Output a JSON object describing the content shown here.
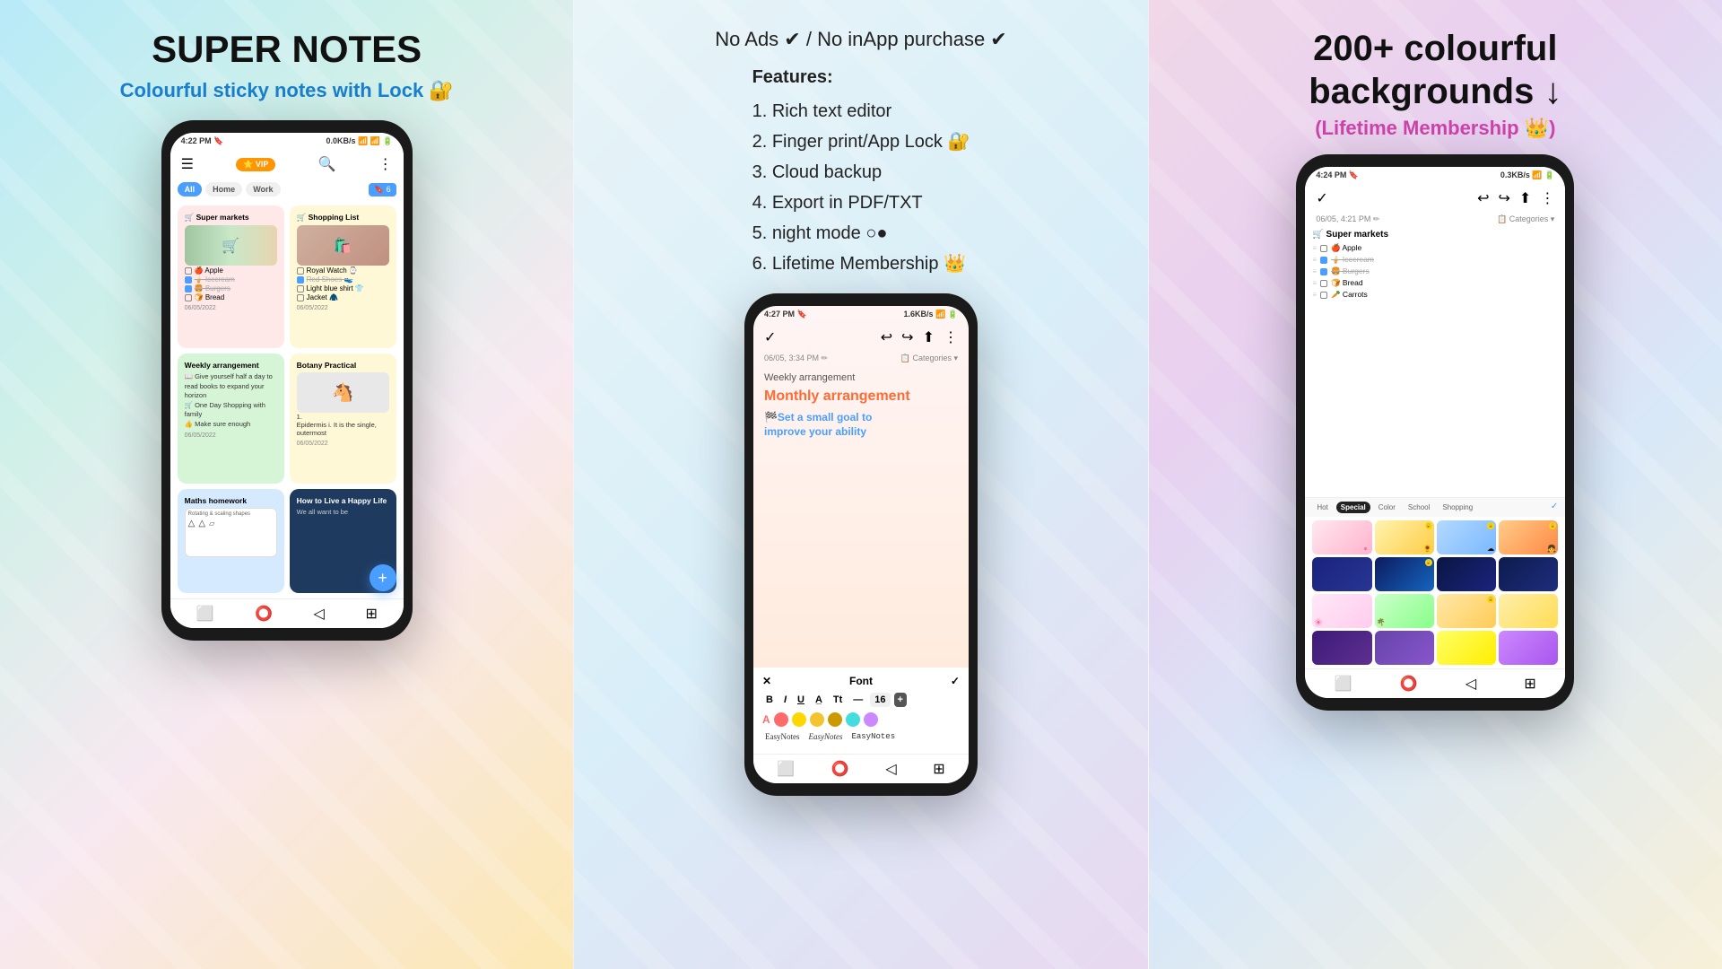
{
  "left_panel": {
    "title": "SUPER NOTES",
    "subtitle": "Colourful sticky notes with Lock 🔐",
    "phone": {
      "time": "4:22 PM",
      "battery": "0.0KB/s",
      "tabs": [
        "All",
        "Home",
        "Work"
      ],
      "notes": [
        {
          "id": "supermarkets",
          "title": "🛒 Super markets",
          "date": "06/05/2022",
          "color": "pink",
          "items": [
            "Apple",
            "Icecream",
            "Burgers",
            "Bread"
          ],
          "checked": [
            false,
            true,
            true,
            false
          ]
        },
        {
          "id": "shopping",
          "title": "🛒 Shopping List",
          "date": "06/05/2022",
          "color": "yellow",
          "items": [
            "Royal Watch",
            "Red Shoes",
            "Light blue shirt",
            "Jacket"
          ],
          "checked": [
            false,
            true,
            false,
            false
          ]
        },
        {
          "id": "weekly",
          "title": "Weekly arrangement",
          "date": "06/05/2022",
          "color": "green",
          "text": "Give yourself half a day to read books to expand your horizon\nOne Day Shopping with family\nMake sure enough"
        },
        {
          "id": "botany",
          "title": "Botany Practical",
          "date": "06/05/2022",
          "color": "yellow",
          "text": "1.\nEpidermis i. It is the single, outermost"
        },
        {
          "id": "maths",
          "title": "Maths homework",
          "date": "",
          "color": "blue",
          "text": "Rotating & scaling shapes"
        },
        {
          "id": "howto",
          "title": "How to Live a Happy Life",
          "date": "",
          "color": "dark-blue",
          "text": "We all want to be"
        }
      ]
    }
  },
  "mid_panel": {
    "no_ads": "No Ads ✔ / No inApp purchase ✔",
    "features_title": "Features:",
    "features": [
      "1. Rich text editor",
      "2. Finger print/App Lock 🔐",
      "3. Cloud backup",
      "4. Export in PDF/TXT",
      "5. night mode ○●",
      "6. Lifetime Membership 👑"
    ],
    "phone": {
      "time": "4:27 PM",
      "note_date": "06/05, 3:34 PM",
      "categories": "Categories",
      "weekly_text": "Weekly arrangement",
      "monthly_text": "Monthly arrangement",
      "goal_text": "🏁Set a small goal to improve your ability",
      "font_toolbar": {
        "title": "Font",
        "close_label": "✕",
        "confirm_label": "✓",
        "size": "16",
        "styles": [
          "B",
          "I",
          "U",
          "A̲",
          "Tt",
          "—",
          "16",
          "+"
        ],
        "colors": [
          "#ff6b6b",
          "#ffd700",
          "#f4c430",
          "#cc9900",
          "#44dddd",
          "#cc88ff"
        ],
        "font_samples": [
          "EasyNotes",
          "EasyNotes",
          "EasyNotes"
        ]
      }
    }
  },
  "right_panel": {
    "title": "200+ colourful\nbackgrounds ↓",
    "subtitle": "(Lifetime Membership 👑)",
    "phone": {
      "time": "4:24 PM",
      "note_date": "06/05, 4:21 PM",
      "categories": "Categories",
      "checklist_title": "🛒 Super markets",
      "items": [
        "🍎 Apple",
        "🍦 Icecream",
        "🍔 Burgers",
        "🍞 Bread",
        "🥕 Carrots"
      ],
      "checked": [
        false,
        true,
        true,
        false,
        false
      ],
      "bg_tabs": [
        "Hot",
        "Special",
        "Color",
        "School",
        "Shopping"
      ],
      "active_tab": "Special",
      "bg_grid": [
        {
          "class": "bg-flowers",
          "locked": false
        },
        {
          "class": "bg-sunflower",
          "locked": true
        },
        {
          "class": "bg-clouds",
          "locked": true
        },
        {
          "class": "bg-girls",
          "locked": true
        },
        {
          "class": "bg-night1",
          "locked": false
        },
        {
          "class": "bg-night2",
          "locked": true
        },
        {
          "class": "bg-night3",
          "locked": false
        },
        {
          "class": "bg-night4",
          "locked": false
        },
        {
          "class": "bg-cherry",
          "locked": false
        },
        {
          "class": "bg-tropical",
          "locked": false
        },
        {
          "class": "bg-beach",
          "locked": true
        },
        {
          "class": "bg-palm",
          "locked": false
        },
        {
          "class": "bg-purple-dark",
          "locked": false
        },
        {
          "class": "bg-purple-med",
          "locked": false
        },
        {
          "class": "bg-yellow-bright",
          "locked": false
        },
        {
          "class": "bg-purple-light",
          "locked": false
        }
      ]
    }
  }
}
